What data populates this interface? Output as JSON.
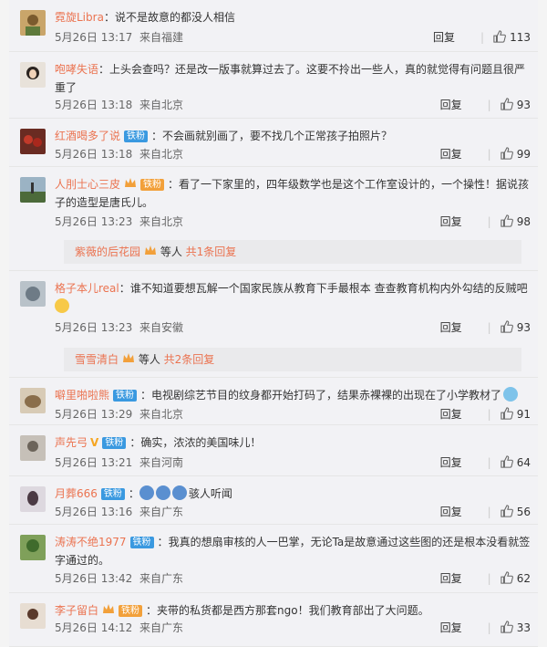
{
  "comments": [
    {
      "user": "霓旋Libra",
      "badge": "",
      "vip": "",
      "crown": false,
      "text": "说不是故意的都没人相信",
      "date": "5月26日 13:17",
      "source": "来自福建",
      "reply": "回复",
      "likes": "113"
    },
    {
      "user": "咆哮失语",
      "badge": "",
      "vip": "",
      "crown": false,
      "text": "上头会查吗？还是改一版事就算过去了。这要不拎出一些人，真的就觉得有问题且很严重了",
      "date": "5月26日 13:18",
      "source": "来自北京",
      "reply": "回复",
      "likes": "93"
    },
    {
      "user": "红酒喝多了说",
      "badge": "铁粉",
      "vip": "",
      "crown": false,
      "text": "不会画就别画了，要不找几个正常孩子拍照片？",
      "date": "5月26日 13:18",
      "source": "来自北京",
      "reply": "回复",
      "likes": "99"
    },
    {
      "user": "人刖士心三皮",
      "badge": "铁粉",
      "vip": "",
      "crown": true,
      "text": "看了一下家里的，四年级数学也是这个工作室设计的，一个操性！据说孩子的造型是唐氏儿。",
      "date": "5月26日 13:23",
      "source": "来自北京",
      "reply": "回复",
      "likes": "98",
      "sub": {
        "user": "紫薇的后花园",
        "rest": " 等人 ",
        "count": "共1条回复"
      }
    },
    {
      "user": "格子本儿real",
      "badge": "",
      "vip": "",
      "crown": false,
      "text": "谁不知道要想瓦解一个国家民族从教育下手最根本 查查教育机构内外勾结的反贼吧",
      "date": "5月26日 13:23",
      "source": "来自安徽",
      "reply": "回复",
      "likes": "93",
      "sub": {
        "user": "雪雪清白",
        "rest": " 等人 ",
        "count": "共2条回复"
      }
    },
    {
      "user": "噼里啪啦熊",
      "badge": "铁粉",
      "vip": "",
      "crown": false,
      "text": "电视剧综艺节目的纹身都开始打码了，结果赤裸裸的出现在了小学教材了",
      "date": "5月26日 13:29",
      "source": "来自北京",
      "reply": "回复",
      "likes": "91"
    },
    {
      "user": "声先弓",
      "badge": "铁粉",
      "vip": "V",
      "crown": false,
      "text": "确实，浓浓的美国味儿！",
      "date": "5月26日 13:21",
      "source": "来自河南",
      "reply": "回复",
      "likes": "64"
    },
    {
      "user": "月葬666",
      "badge": "铁粉",
      "vip": "",
      "crown": false,
      "text": "骇人听闻",
      "date": "5月26日 13:16",
      "source": "来自广东",
      "reply": "回复",
      "likes": "56"
    },
    {
      "user": "涛涛不绝1977",
      "badge": "铁粉",
      "vip": "",
      "crown": false,
      "text": "我真的想扇审核的人一巴掌，无论Ta是故意通过这些图的还是根本没看就签字通过的。",
      "date": "5月26日 13:42",
      "source": "来自广东",
      "reply": "回复",
      "likes": "62"
    },
    {
      "user": "李子留白",
      "badge": "铁粉",
      "vip": "",
      "crown": true,
      "text": "夹带的私货都是西方那套ngo！我们教育部出了大问题。",
      "date": "5月26日 14:12",
      "source": "来自广东",
      "reply": "回复",
      "likes": "33"
    }
  ],
  "colors": {
    "username": "#eb7350",
    "fan_badge": "#3a99e0",
    "gold_badge": "#f2a03a",
    "text": "#333333",
    "meta": "#666666"
  },
  "icons": {
    "like": "thumbs-up-icon",
    "crown": "crown-icon",
    "vip": "vip-v-icon"
  }
}
